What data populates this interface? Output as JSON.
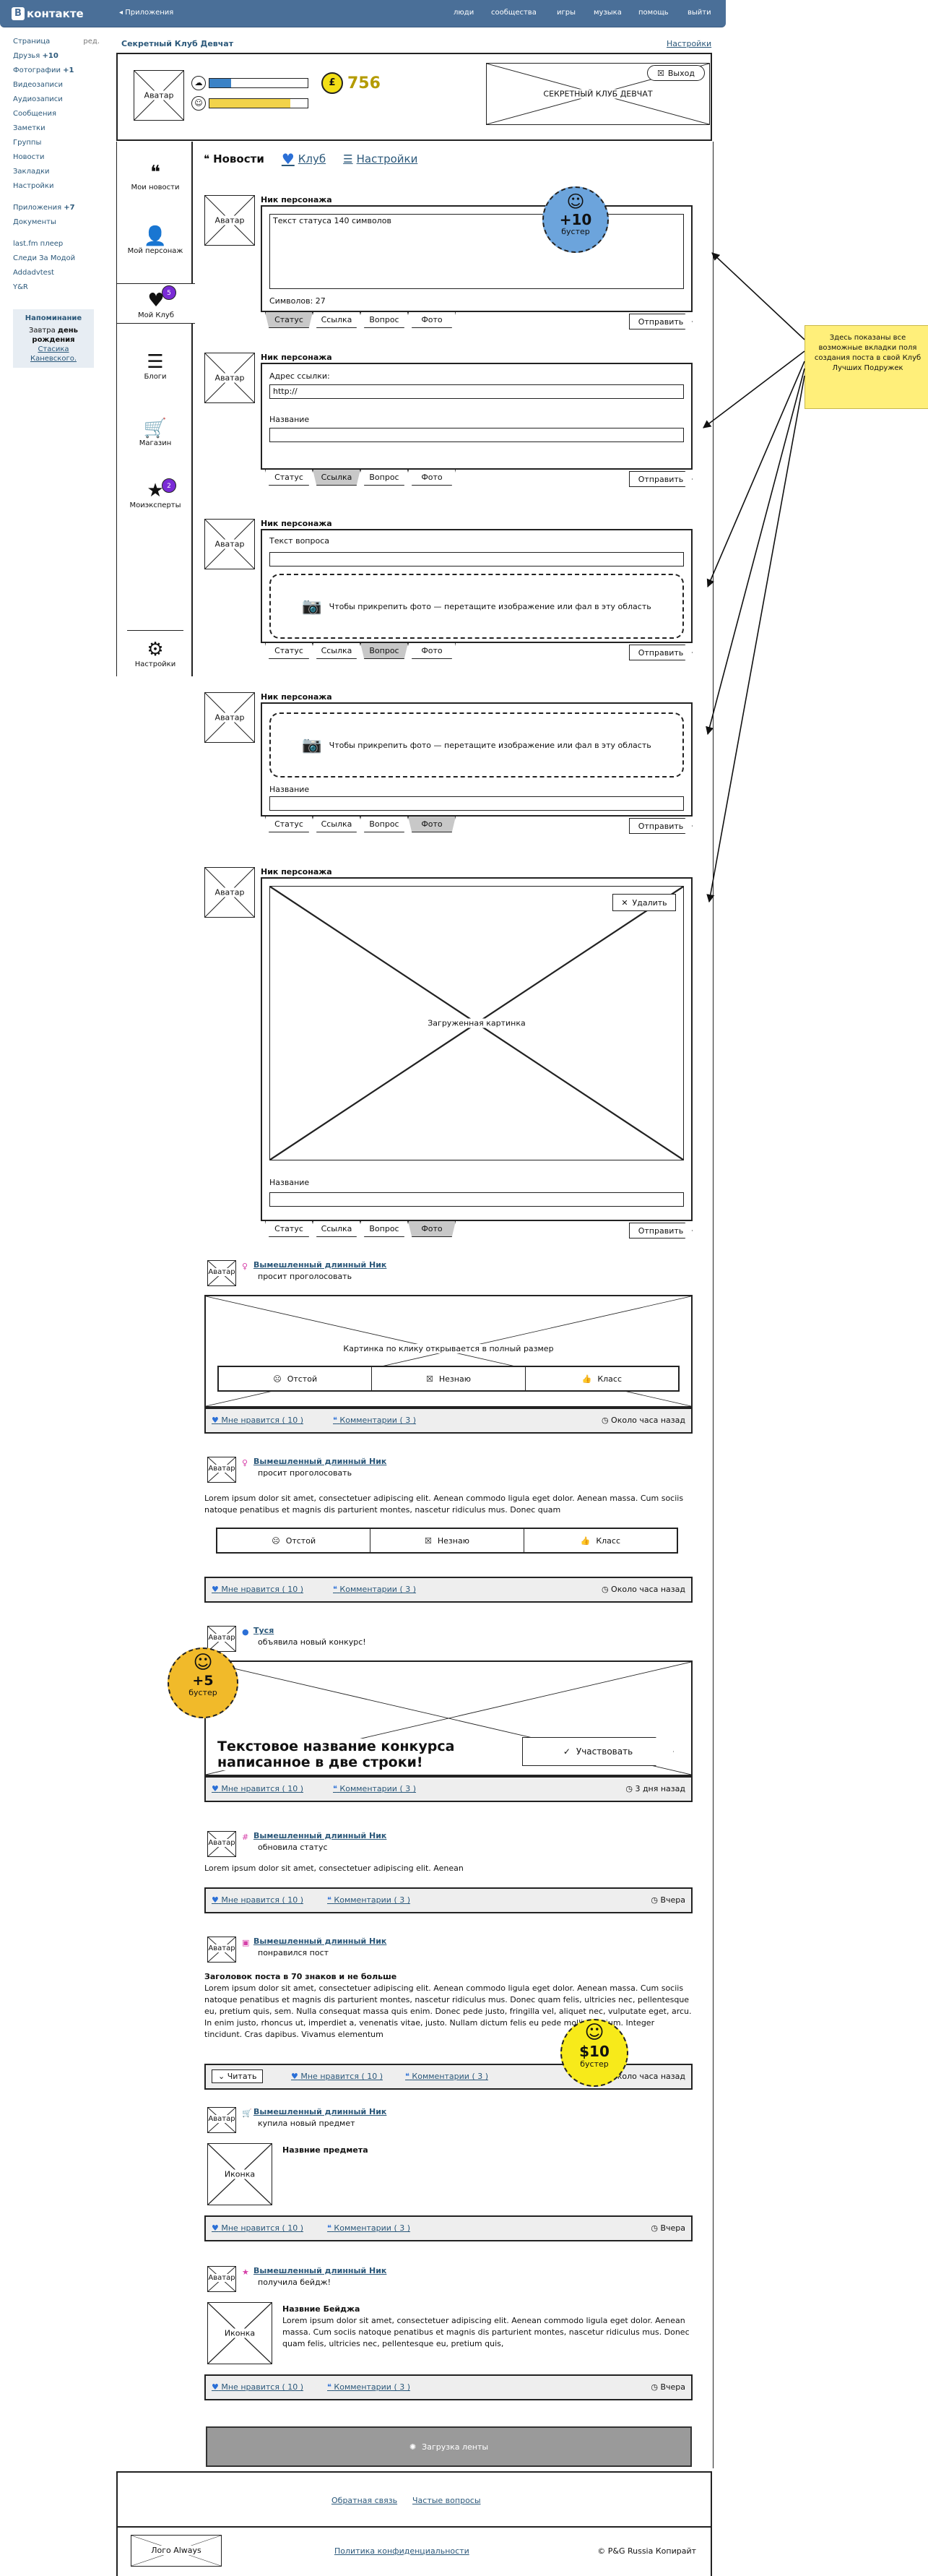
{
  "topbar": {
    "logo_text": "контакте",
    "logo_letter": "В",
    "apps_link": "◂ Приложения",
    "nav": [
      "люди",
      "сообщества",
      "игры",
      "музыка",
      "помощь",
      "выйти"
    ]
  },
  "leftmenu": {
    "items": [
      {
        "label": "Страница",
        "extra": "ред."
      },
      {
        "label": "Друзья",
        "count": "+10"
      },
      {
        "label": "Фотографии",
        "count": "+1"
      },
      {
        "label": "Видеозаписи"
      },
      {
        "label": "Аудиозаписи"
      },
      {
        "label": "Сообщения"
      },
      {
        "label": "Заметки"
      },
      {
        "label": "Группы"
      },
      {
        "label": "Новости"
      },
      {
        "label": "Закладки"
      },
      {
        "label": "Настройки"
      }
    ],
    "items2": [
      {
        "label": "Приложения",
        "count": "+7"
      },
      {
        "label": "Документы"
      }
    ],
    "items3": [
      {
        "label": "last.fm плеер"
      },
      {
        "label": "Следи За Модой"
      },
      {
        "label": "Addadvtest"
      },
      {
        "label": "Y&R"
      }
    ],
    "reminder_title": "Напоминание",
    "reminder_pre": "Завтра",
    "reminder_bold": "день рождения",
    "reminder_name": "Стасика Каневского."
  },
  "header": {
    "club_title": "Секретный Клуб Девчат",
    "settings": "Настройки",
    "avatar": "Аватар",
    "coin_symbol": "£",
    "coin_value": "756",
    "bar1_fill": 0.22,
    "bar2_fill": 0.82,
    "bar1_color": "#3b82c6",
    "bar2_color": "#f2d34a",
    "club_logo": "СЕКРЕТНЫЙ КЛУБ ДЕВЧАТ",
    "exit": "Выход"
  },
  "sidenav": [
    {
      "label": "Мои новости",
      "icon": "news-icon"
    },
    {
      "label": "Мой персонаж",
      "icon": "person-icon"
    },
    {
      "label": "Мой Клуб",
      "icon": "heart-icon",
      "badge": "5"
    },
    {
      "label": "Блоги",
      "icon": "blog-icon"
    },
    {
      "label": "Магазин",
      "icon": "cart-icon"
    },
    {
      "label": "Моиэксперты",
      "icon": "star-icon",
      "badge": "2"
    },
    {
      "label": "Настройки",
      "icon": "gear-icon"
    }
  ],
  "tabs": {
    "news": "Новости",
    "club": "Клуб",
    "settings": "Настройки"
  },
  "composer": {
    "nick": "Ник персонажа",
    "avatar": "Аватар",
    "tab_labels": [
      "Статус",
      "Ссылка",
      "Вопрос",
      "Фото"
    ],
    "send": "Отправить",
    "status_placeholder": "Текст статуса 140 символов",
    "status_counter": "Символов: 27",
    "link_label": "Адрес ссылки:",
    "link_value": "http://",
    "name_label": "Название",
    "question_label": "Текст вопроса",
    "drop_text": "Чтобы прикрепить фото — перетащите изображение или фал в эту область",
    "delete": "Удалить",
    "uploaded": "Загруженная картинка",
    "booster_value": "+10",
    "booster_label": "бустер"
  },
  "feed": {
    "avatar": "Аватар",
    "nick": "Вымешленный длинный Ник",
    "like": "Мне нравится ( 10 )",
    "comments": "Комментарии ( 3 )",
    "vote_bad": "Отстой",
    "vote_mid": "Незнаю",
    "vote_good": "Класс",
    "item1": {
      "action": "просит проголосовать",
      "image": "Картинка по клику открывается в полный размер",
      "time": "Около часа назад"
    },
    "item2": {
      "action": "просит проголосовать",
      "text": "Lorem ipsum dolor sit amet, consectetuer adipiscing elit. Aenean commodo ligula eget dolor. Aenean massa. Cum sociis natoque penatibus et magnis dis parturient montes, nascetur ridiculus mus. Donec quam",
      "time": "Около часа назад"
    },
    "item3": {
      "nick": "Туся",
      "action": "объявила новый конкурс!",
      "contest": "Текстовое название конкурса написанное в две строки!",
      "join": "Участвовать",
      "time": "3 дня назад",
      "booster_value": "+5",
      "booster_label": "бустер"
    },
    "item4": {
      "action": "обновила статус",
      "text": "Lorem ipsum dolor sit amet, consectetuer adipiscing elit. Aenean",
      "time": "Вчера"
    },
    "item5": {
      "action": "понравился пост",
      "title": "Заголовок поста в 70 знаков и не больше",
      "text": "Lorem ipsum dolor sit amet, consectetuer adipiscing elit. Aenean commodo ligula eget dolor. Aenean massa. Cum sociis natoque penatibus et magnis dis parturient montes, nascetur ridiculus mus. Donec quam felis, ultricies nec, pellentesque eu, pretium quis, sem. Nulla consequat massa quis enim. Donec pede justo, fringilla vel, aliquet nec, vulputate eget, arcu. In enim justo, rhoncus ut, imperdiet a, venenatis vitae, justo. Nullam dictum felis eu pede mollis pretium. Integer tincidunt. Cras dapibus. Vivamus elementum",
      "read": "Читать",
      "time": "Около часа назад",
      "booster_value": "$10",
      "booster_label": "бустер"
    },
    "item6": {
      "action": "купила новый предмет",
      "icon": "Иконка",
      "title": "Назвние предмета",
      "time": "Вчера"
    },
    "item7": {
      "action": "получила бейдж!",
      "icon": "Иконка",
      "title": "Назвние Бейджа",
      "text": "Lorem ipsum dolor sit amet, consectetuer adipiscing elit. Aenean commodo ligula eget dolor. Aenean massa. Cum sociis natoque penatibus et magnis dis parturient montes, nascetur ridiculus mus. Donec quam felis, ultricies nec, pellentesque eu, pretium quis,",
      "time": "Вчера"
    },
    "loading": "Загрузка ленты"
  },
  "note": "Здесь показаны все возможные вкладки поля создания поста в свой Клуб Лучших Подружек",
  "footer": {
    "feedback": "Обратная связь",
    "faq": "Частые вопросы",
    "logo": "Лого Always",
    "privacy": "Политика конфиденциальности",
    "copyright": "© P&G Russia Копирайт"
  }
}
